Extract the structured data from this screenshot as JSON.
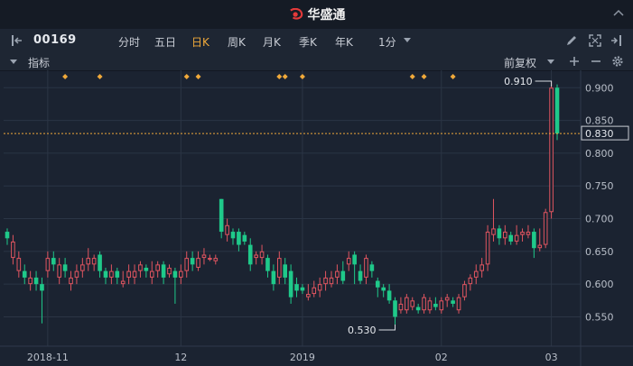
{
  "app": {
    "brand": "华盛通"
  },
  "toolbar": {
    "code": "00169",
    "periods": [
      "分时",
      "五日",
      "日K",
      "周K",
      "月K",
      "季K",
      "年K"
    ],
    "active_period": "日K",
    "minute_label": "1分",
    "icons": [
      "pencil-icon",
      "expand-icon",
      "exit-icon"
    ]
  },
  "indicator_bar": {
    "label": "指标",
    "adjust_label": "前复权",
    "icons": [
      "plus-icon",
      "minus-icon",
      "gear-icon"
    ]
  },
  "colors": {
    "up": "#e05560",
    "down": "#1fc98a",
    "marker": "#f0a93a",
    "grid": "#2b3545",
    "bg": "#1b2331"
  },
  "chart_data": {
    "type": "candlestick",
    "y_ticks": [
      "0.900",
      "0.850",
      "0.800",
      "0.750",
      "0.700",
      "0.650",
      "0.600",
      "0.550"
    ],
    "y_range": [
      0.525,
      0.92
    ],
    "x_labels": [
      {
        "label": "2018-11",
        "index": 7
      },
      {
        "label": "12",
        "index": 30
      },
      {
        "label": "2019",
        "index": 51
      },
      {
        "label": "02",
        "index": 75
      },
      {
        "label": "03",
        "index": 94
      }
    ],
    "current_price": "0.830",
    "max_label": "0.910",
    "min_label": "0.530",
    "marker_indices": [
      10,
      16,
      31,
      33,
      47,
      48,
      51,
      70,
      72,
      77
    ],
    "candles": [
      [
        0.68,
        0.67,
        0.685,
        0.66
      ],
      [
        0.64,
        0.665,
        0.675,
        0.63
      ],
      [
        0.62,
        0.64,
        0.65,
        0.61
      ],
      [
        0.62,
        0.61,
        0.63,
        0.6
      ],
      [
        0.6,
        0.61,
        0.62,
        0.59
      ],
      [
        0.61,
        0.6,
        0.62,
        0.59
      ],
      [
        0.6,
        0.59,
        0.61,
        0.54
      ],
      [
        0.62,
        0.64,
        0.65,
        0.61
      ],
      [
        0.64,
        0.63,
        0.65,
        0.62
      ],
      [
        0.61,
        0.63,
        0.64,
        0.6
      ],
      [
        0.63,
        0.62,
        0.64,
        0.61
      ],
      [
        0.6,
        0.61,
        0.62,
        0.59
      ],
      [
        0.61,
        0.62,
        0.63,
        0.6
      ],
      [
        0.62,
        0.63,
        0.64,
        0.61
      ],
      [
        0.63,
        0.64,
        0.655,
        0.62
      ],
      [
        0.63,
        0.64,
        0.645,
        0.62
      ],
      [
        0.645,
        0.62,
        0.65,
        0.61
      ],
      [
        0.62,
        0.61,
        0.625,
        0.6
      ],
      [
        0.61,
        0.62,
        0.63,
        0.6
      ],
      [
        0.62,
        0.61,
        0.625,
        0.6
      ],
      [
        0.6,
        0.605,
        0.62,
        0.595
      ],
      [
        0.61,
        0.62,
        0.63,
        0.6
      ],
      [
        0.61,
        0.62,
        0.63,
        0.6
      ],
      [
        0.62,
        0.63,
        0.635,
        0.61
      ],
      [
        0.625,
        0.62,
        0.63,
        0.61
      ],
      [
        0.61,
        0.62,
        0.635,
        0.6
      ],
      [
        0.62,
        0.63,
        0.635,
        0.61
      ],
      [
        0.63,
        0.61,
        0.635,
        0.6
      ],
      [
        0.615,
        0.625,
        0.63,
        0.61
      ],
      [
        0.62,
        0.61,
        0.625,
        0.57
      ],
      [
        0.61,
        0.62,
        0.63,
        0.6
      ],
      [
        0.62,
        0.64,
        0.65,
        0.61
      ],
      [
        0.64,
        0.63,
        0.65,
        0.62
      ],
      [
        0.625,
        0.64,
        0.65,
        0.62
      ],
      [
        0.64,
        0.645,
        0.655,
        0.63
      ],
      [
        0.64,
        0.64,
        0.645,
        0.635
      ],
      [
        0.635,
        0.64,
        0.645,
        0.63
      ],
      [
        0.73,
        0.68,
        0.73,
        0.67
      ],
      [
        0.675,
        0.69,
        0.7,
        0.665
      ],
      [
        0.68,
        0.67,
        0.685,
        0.66
      ],
      [
        0.68,
        0.66,
        0.685,
        0.65
      ],
      [
        0.675,
        0.665,
        0.68,
        0.66
      ],
      [
        0.66,
        0.63,
        0.67,
        0.62
      ],
      [
        0.64,
        0.645,
        0.65,
        0.63
      ],
      [
        0.64,
        0.65,
        0.66,
        0.63
      ],
      [
        0.64,
        0.62,
        0.645,
        0.61
      ],
      [
        0.62,
        0.6,
        0.63,
        0.59
      ],
      [
        0.61,
        0.64,
        0.65,
        0.6
      ],
      [
        0.63,
        0.61,
        0.64,
        0.6
      ],
      [
        0.62,
        0.58,
        0.63,
        0.57
      ],
      [
        0.6,
        0.59,
        0.61,
        0.58
      ],
      [
        0.595,
        0.59,
        0.6,
        0.585
      ],
      [
        0.58,
        0.585,
        0.6,
        0.575
      ],
      [
        0.585,
        0.595,
        0.605,
        0.58
      ],
      [
        0.59,
        0.6,
        0.61,
        0.58
      ],
      [
        0.6,
        0.61,
        0.62,
        0.59
      ],
      [
        0.6,
        0.61,
        0.62,
        0.595
      ],
      [
        0.61,
        0.62,
        0.63,
        0.6
      ],
      [
        0.62,
        0.605,
        0.635,
        0.6
      ],
      [
        0.63,
        0.64,
        0.65,
        0.62
      ],
      [
        0.645,
        0.63,
        0.65,
        0.6
      ],
      [
        0.62,
        0.605,
        0.63,
        0.6
      ],
      [
        0.61,
        0.64,
        0.645,
        0.6
      ],
      [
        0.63,
        0.62,
        0.635,
        0.61
      ],
      [
        0.605,
        0.595,
        0.61,
        0.58
      ],
      [
        0.595,
        0.59,
        0.6,
        0.58
      ],
      [
        0.59,
        0.575,
        0.6,
        0.57
      ],
      [
        0.575,
        0.55,
        0.58,
        0.53
      ],
      [
        0.56,
        0.57,
        0.58,
        0.555
      ],
      [
        0.56,
        0.58,
        0.585,
        0.555
      ],
      [
        0.565,
        0.575,
        0.58,
        0.56
      ],
      [
        0.565,
        0.56,
        0.57,
        0.555
      ],
      [
        0.56,
        0.58,
        0.585,
        0.555
      ],
      [
        0.56,
        0.575,
        0.58,
        0.555
      ],
      [
        0.57,
        0.565,
        0.58,
        0.56
      ],
      [
        0.56,
        0.575,
        0.58,
        0.555
      ],
      [
        0.575,
        0.58,
        0.585,
        0.565
      ],
      [
        0.575,
        0.57,
        0.58,
        0.565
      ],
      [
        0.56,
        0.58,
        0.585,
        0.555
      ],
      [
        0.58,
        0.6,
        0.605,
        0.575
      ],
      [
        0.6,
        0.61,
        0.615,
        0.59
      ],
      [
        0.61,
        0.62,
        0.63,
        0.6
      ],
      [
        0.62,
        0.63,
        0.64,
        0.61
      ],
      [
        0.63,
        0.68,
        0.69,
        0.62
      ],
      [
        0.675,
        0.685,
        0.73,
        0.665
      ],
      [
        0.685,
        0.67,
        0.69,
        0.66
      ],
      [
        0.67,
        0.68,
        0.69,
        0.66
      ],
      [
        0.675,
        0.665,
        0.68,
        0.66
      ],
      [
        0.665,
        0.675,
        0.69,
        0.66
      ],
      [
        0.675,
        0.68,
        0.685,
        0.665
      ],
      [
        0.675,
        0.68,
        0.69,
        0.67
      ],
      [
        0.68,
        0.655,
        0.685,
        0.64
      ],
      [
        0.655,
        0.66,
        0.685,
        0.65
      ],
      [
        0.66,
        0.71,
        0.715,
        0.655
      ],
      [
        0.71,
        0.9,
        0.91,
        0.7
      ],
      [
        0.9,
        0.83,
        0.905,
        0.82
      ]
    ]
  }
}
